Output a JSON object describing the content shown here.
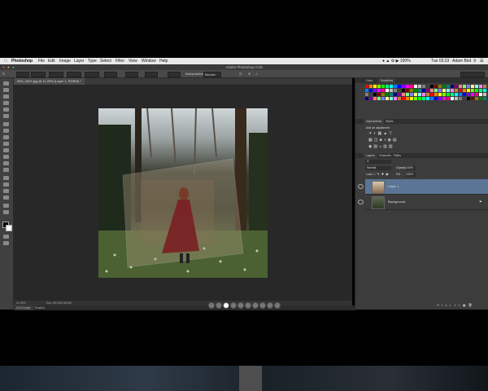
{
  "menubar": {
    "apple_icon": "apple-icon",
    "items": [
      "Photoshop",
      "File",
      "Edit",
      "Image",
      "Layer",
      "Type",
      "Select",
      "Filter",
      "View",
      "Window",
      "Help"
    ],
    "clock": "Tue 03:23",
    "user": "Adam Bird"
  },
  "app": {
    "title": "Adobe Photoshop CS6"
  },
  "options": {
    "interpolation_label": "Interpolation:",
    "interpolation_value": "Bicubic"
  },
  "document": {
    "tab_label": "IMG_0457.jpg @ 11.25% (Layer 1, RGB/8) *",
    "zoom": "11.25%",
    "doc_size": "Doc: 69.2M/138.5M"
  },
  "bottom_tabs": [
    "Mini Bridge",
    "Timeline"
  ],
  "panels": {
    "swatches_tabs": [
      "Color",
      "Swatches"
    ],
    "adjustments_tabs": [
      "Adjustments",
      "Styles"
    ],
    "adjustments_title": "Add an adjustment",
    "layers_tabs": [
      "Layers",
      "Channels",
      "Paths"
    ],
    "blend_mode": "Normal",
    "opacity_label": "Opacity:",
    "opacity_value": "100%",
    "lock_label": "Lock:",
    "fill_label": "Fill:",
    "fill_value": "100%",
    "layers": [
      {
        "name": "Layer 1",
        "selected": true
      },
      {
        "name": "Background",
        "selected": false
      }
    ]
  },
  "pagination": {
    "count": 10,
    "active_index": 2
  },
  "colors": {
    "accent": "#5a7595",
    "chrome": "#3c3c3c",
    "workspace": "#282828"
  }
}
